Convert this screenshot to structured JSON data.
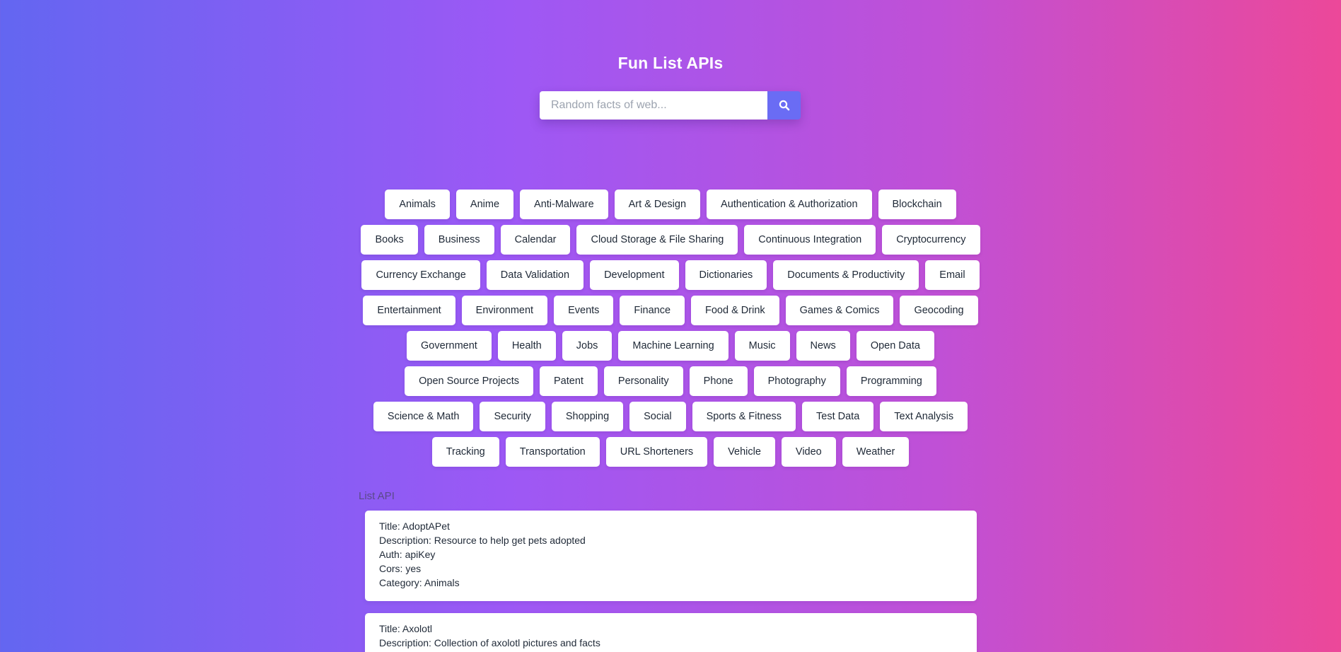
{
  "header": {
    "title": "Fun List APIs"
  },
  "search": {
    "placeholder": "Random facts of web...",
    "value": "",
    "icon": "search-icon"
  },
  "categories": [
    "Animals",
    "Anime",
    "Anti-Malware",
    "Art & Design",
    "Authentication & Authorization",
    "Blockchain",
    "Books",
    "Business",
    "Calendar",
    "Cloud Storage & File Sharing",
    "Continuous Integration",
    "Cryptocurrency",
    "Currency Exchange",
    "Data Validation",
    "Development",
    "Dictionaries",
    "Documents & Productivity",
    "Email",
    "Entertainment",
    "Environment",
    "Events",
    "Finance",
    "Food & Drink",
    "Games & Comics",
    "Geocoding",
    "Government",
    "Health",
    "Jobs",
    "Machine Learning",
    "Music",
    "News",
    "Open Data",
    "Open Source Projects",
    "Patent",
    "Personality",
    "Phone",
    "Photography",
    "Programming",
    "Science & Math",
    "Security",
    "Shopping",
    "Social",
    "Sports & Fitness",
    "Test Data",
    "Text Analysis",
    "Tracking",
    "Transportation",
    "URL Shorteners",
    "Vehicle",
    "Video",
    "Weather"
  ],
  "list": {
    "label": "List API",
    "items": [
      {
        "title": "Title: AdoptAPet",
        "description": "Description: Resource to help get pets adopted",
        "auth": "Auth: apiKey",
        "cors": "Cors: yes",
        "category": "Category: Animals"
      },
      {
        "title": "Title: Axolotl",
        "description": "Description: Collection of axolotl pictures and facts",
        "auth": "",
        "cors": "",
        "category": ""
      }
    ]
  },
  "colors": {
    "gradient_start": "#6366f1",
    "gradient_mid": "#a855f7",
    "gradient_end": "#ec4899",
    "search_button": "#6a6cf4"
  }
}
